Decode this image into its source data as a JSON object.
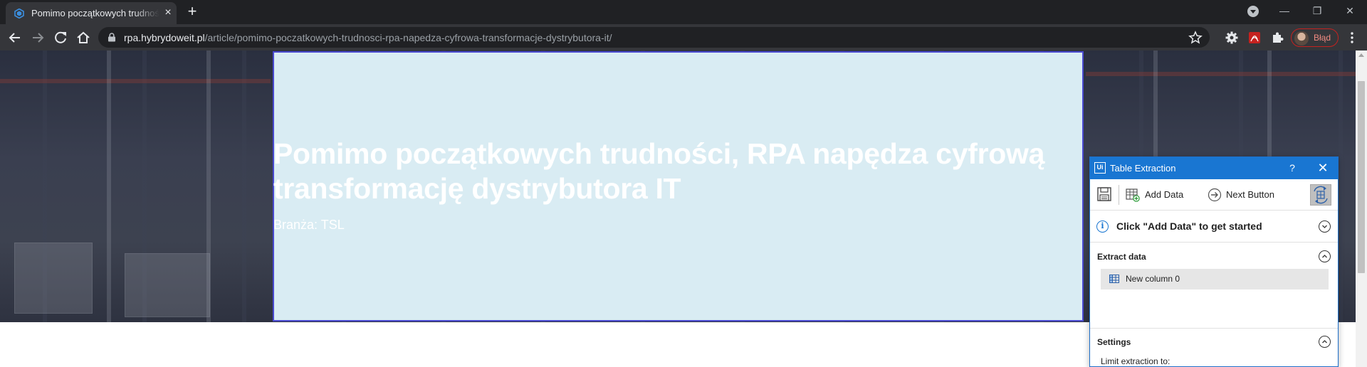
{
  "browser": {
    "tab": {
      "title": "Pomimo początkowych trudności, RPA napędza cyfrową transformację dystrybutora IT",
      "close": "×"
    },
    "new_tab": "+",
    "window_controls": {
      "minimize": "—",
      "restore": "❐",
      "close": "✕"
    },
    "url": {
      "host": "rpa.hybrydoweit.pl",
      "path": "/article/pomimo-poczatkowych-trudnosci-rpa-napedza-cyfrowa-transformacje-dystrybutora-it/"
    },
    "profile": {
      "label": "Błąd"
    },
    "icons": [
      "back-icon",
      "forward-icon",
      "reload-icon",
      "home-icon",
      "lock-icon",
      "star-icon",
      "gear-extension-icon",
      "pdf-extension-icon",
      "puzzle-extensions-icon",
      "menu-icon"
    ]
  },
  "article": {
    "headline": "Pomimo początkowych trudności, RPA napędza cyfrową transformację dystrybutora IT",
    "category": "Branża: TSL"
  },
  "wizard": {
    "title": "Table Extraction",
    "help": "?",
    "close": "✕",
    "toolbar": {
      "add_data": "Add Data",
      "next_button": "Next Button"
    },
    "info": "Click \"Add Data\" to get started",
    "extract_data": {
      "label": "Extract data",
      "columns": [
        "New column 0"
      ]
    },
    "settings": {
      "label": "Settings",
      "limit_label": "Limit extraction to:"
    },
    "colors": {
      "titlebar": "#1976d2"
    }
  }
}
